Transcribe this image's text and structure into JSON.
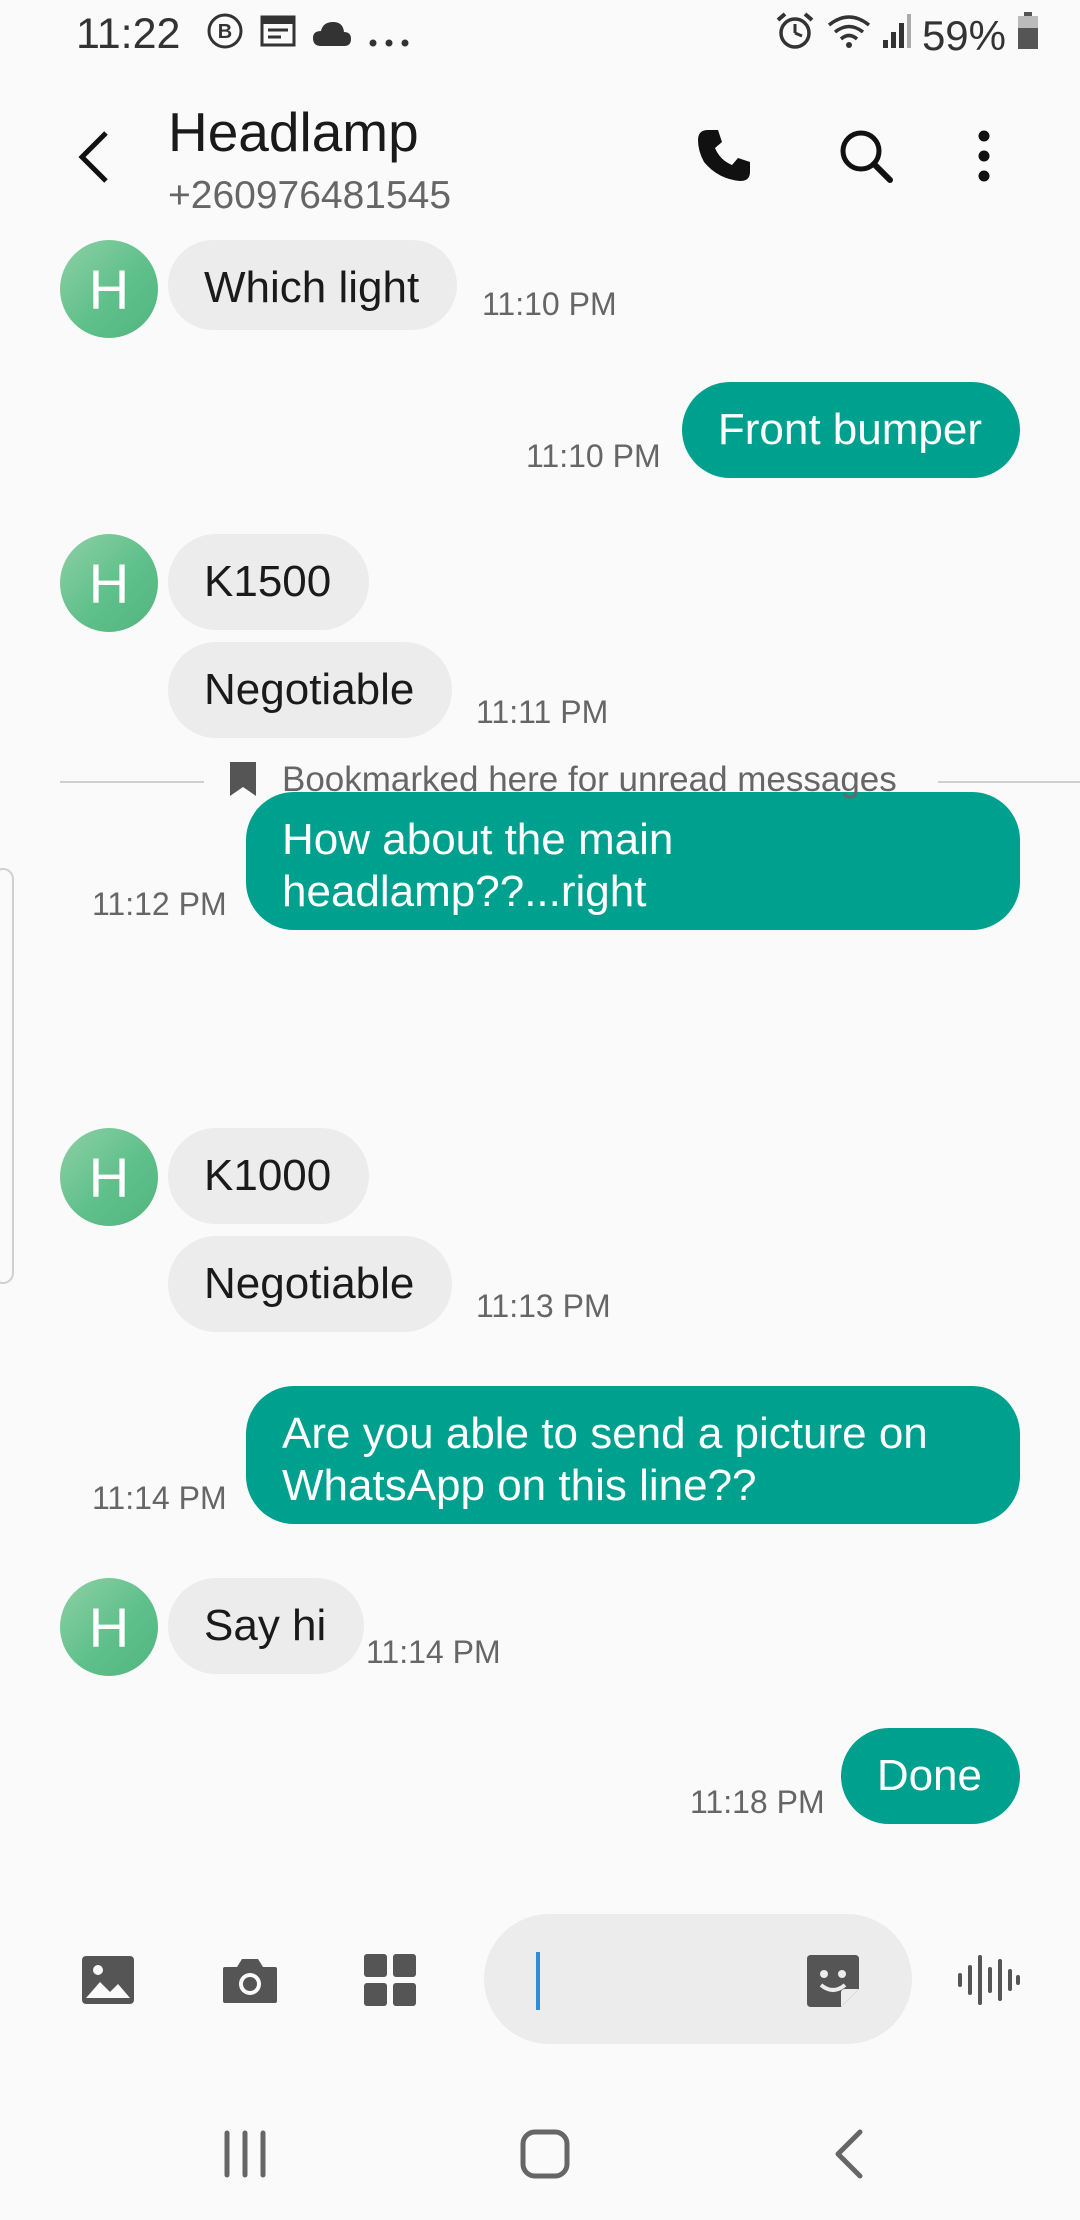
{
  "status_bar": {
    "time": "11:22",
    "left_icons": [
      "b-badge-icon",
      "calendar-icon",
      "cloud-icon",
      "more-dots-icon"
    ],
    "right_icons": [
      "alarm-icon",
      "wifi-icon",
      "signal-icon",
      "battery-icon"
    ],
    "battery_percent": "59%"
  },
  "header": {
    "contact_name": "Headlamp",
    "contact_number": "+260976481545",
    "actions": [
      "phone-icon",
      "search-icon",
      "more-options-icon"
    ]
  },
  "messages": [
    {
      "direction": "in",
      "avatar": "H",
      "text": "Which light",
      "time": "11:10 PM"
    },
    {
      "direction": "out",
      "text": "Front bumper",
      "time": "11:10 PM"
    },
    {
      "direction": "in",
      "avatar": "H",
      "text": "K1500",
      "time": ""
    },
    {
      "direction": "in",
      "text": "Negotiable",
      "time": "11:11 PM"
    },
    {
      "direction": "out",
      "text": "How about the main\nheadlamp??...right",
      "time": "11:12 PM"
    },
    {
      "direction": "in",
      "avatar": "H",
      "text": "K1000",
      "time": ""
    },
    {
      "direction": "in",
      "text": "Negotiable",
      "time": "11:13 PM"
    },
    {
      "direction": "out",
      "text": "Are you able to send a picture on\nWhatsApp on this line??",
      "time": "11:14 PM"
    },
    {
      "direction": "in",
      "avatar": "H",
      "text": "Say hi",
      "time": "11:14 PM"
    },
    {
      "direction": "out",
      "text": "Done",
      "time": "11:18 PM"
    }
  ],
  "bookmark": {
    "text": "Bookmarked here for unread messages"
  },
  "composer": {
    "icons": [
      "gallery-icon",
      "camera-icon",
      "apps-grid-icon",
      "sticker-icon",
      "voice-recorder-icon"
    ],
    "input_value": ""
  },
  "nav": {
    "icons": [
      "recent-apps-icon",
      "home-icon",
      "back-icon"
    ]
  },
  "colors": {
    "outgoing_bubble": "#00a08f",
    "incoming_bubble": "#ececec",
    "avatar": "#5fc08a",
    "background": "#fafafa"
  }
}
